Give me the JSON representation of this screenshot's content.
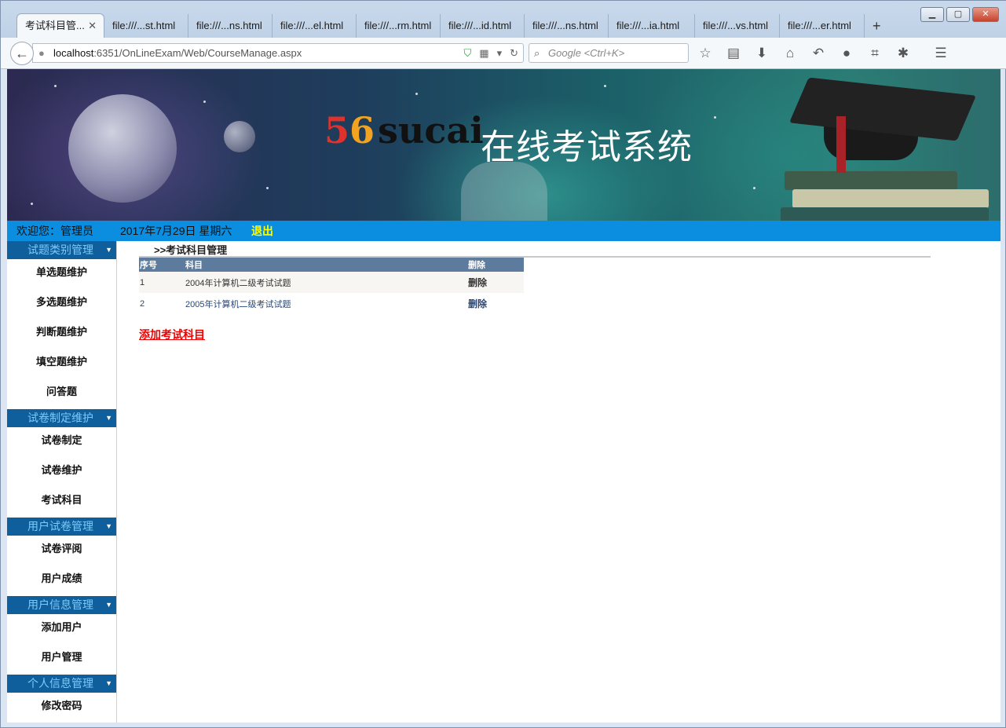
{
  "browser": {
    "tabs": [
      {
        "label": "考试科目管...",
        "active": true
      },
      {
        "label": "file:///...st.html"
      },
      {
        "label": "file:///...ns.html"
      },
      {
        "label": "file:///...el.html"
      },
      {
        "label": "file:///...rm.html"
      },
      {
        "label": "file:///...id.html"
      },
      {
        "label": "file:///...ns.html"
      },
      {
        "label": "file:///...ia.html"
      },
      {
        "label": "file:///...vs.html"
      },
      {
        "label": "file:///...er.html"
      }
    ],
    "tab_close": "✕",
    "new_tab": "+",
    "url_host": "localhost",
    "url_rest": ":6351/OnLineExam/Web/CourseManage.aspx",
    "search_placeholder": "Google <Ctrl+K>"
  },
  "banner": {
    "logo_digit1": "5",
    "logo_digit2": "6",
    "logo_word": "sucai",
    "title": "在线考试系统"
  },
  "infobar": {
    "welcome": "欢迎您：管理员",
    "date": "2017年7月29日 星期六",
    "logout": "退出"
  },
  "sidebar": {
    "sections": [
      {
        "title": "试题类别管理",
        "items": [
          "单选题维护",
          "多选题维护",
          "判断题维护",
          "填空题维护",
          "问答题"
        ]
      },
      {
        "title": "试卷制定维护",
        "items": [
          "试卷制定",
          "试卷维护",
          "考试科目"
        ]
      },
      {
        "title": "用户试卷管理",
        "items": [
          "试卷评阅",
          "用户成绩"
        ]
      },
      {
        "title": "用户信息管理",
        "items": [
          "添加用户",
          "用户管理"
        ]
      },
      {
        "title": "个人信息管理",
        "items": [
          "修改密码"
        ]
      }
    ]
  },
  "main": {
    "breadcrumb": ">>考试科目管理",
    "table": {
      "headers": [
        "序号",
        "科目",
        "删除"
      ],
      "rows": [
        {
          "no": "1",
          "subject": "2004年计算机二级考试试题",
          "action": "删除"
        },
        {
          "no": "2",
          "subject": "2005年计算机二级考试试题",
          "action": "删除"
        }
      ]
    },
    "add_link": "添加考试科目"
  }
}
